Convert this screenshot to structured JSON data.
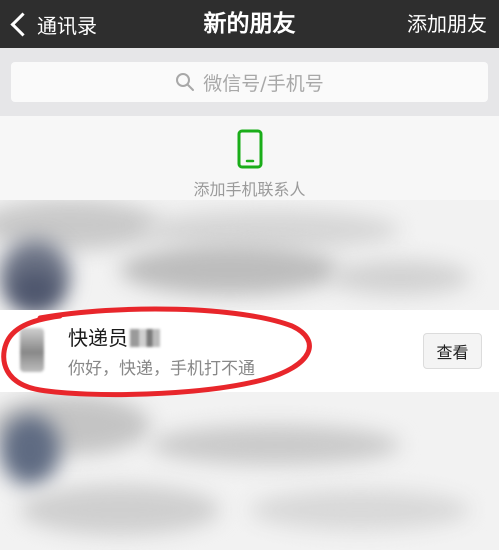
{
  "navbar": {
    "back_label": "通讯录",
    "title": "新的朋友",
    "action_label": "添加朋友"
  },
  "search": {
    "placeholder": "微信号/手机号"
  },
  "add_phone_contacts": {
    "label": "添加手机联系人",
    "icon": "mobile-phone-icon",
    "icon_color": "#1aad19"
  },
  "friend_requests": [
    {
      "name": "快递员",
      "message": "你好，快递，手机打不通",
      "button_label": "查看"
    }
  ],
  "colors": {
    "navbar_bg": "#2e2e2e",
    "annotation_red": "#e8262b",
    "wechat_green": "#1aad19"
  }
}
